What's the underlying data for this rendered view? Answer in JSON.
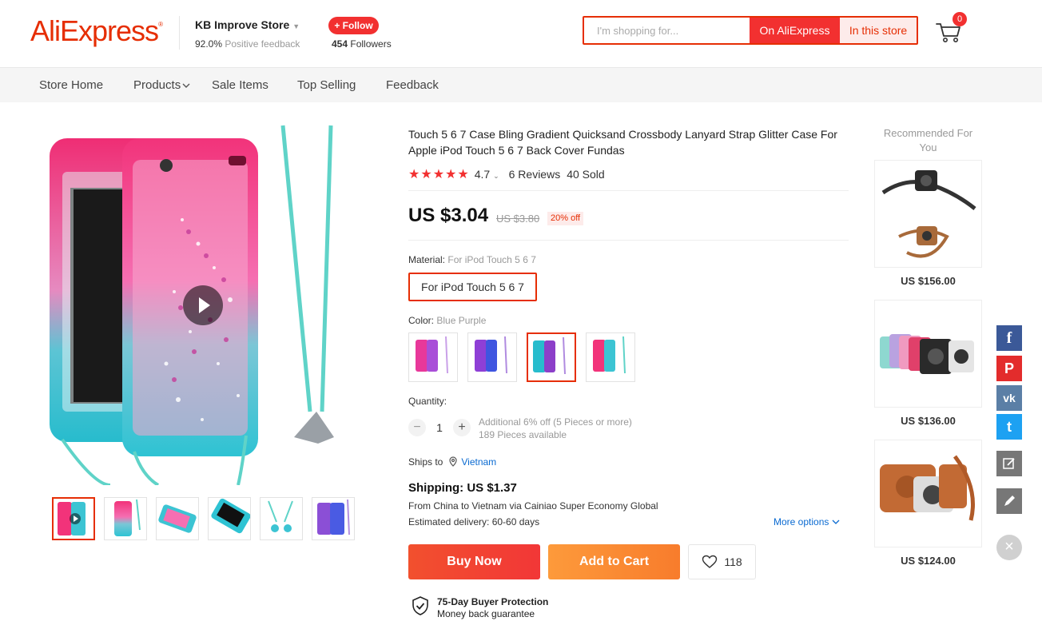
{
  "header": {
    "logo": "AliExpress",
    "logo_mark": "®",
    "store_name": "KB Improve Store",
    "feedback_pct": "92.0%",
    "feedback_label": "Positive feedback",
    "follow_label": "+ Follow",
    "followers_count": "454",
    "followers_label": "Followers",
    "search_placeholder": "I'm shopping for...",
    "search_aliexpress": "On AliExpress",
    "search_store": "In this store",
    "cart_count": "0"
  },
  "nav": {
    "items": [
      "Store Home",
      "Products",
      "Sale Items",
      "Top Selling",
      "Feedback"
    ]
  },
  "product": {
    "title": "Touch 5 6 7 Case Bling Gradient Quicksand Crossbody Lanyard Strap Glitter Case For Apple iPod Touch 5 6 7 Back Cover Fundas",
    "stars": "★★★★★",
    "rating": "4.7",
    "reviews": "6 Reviews",
    "sold": "40 Sold",
    "price": "US $3.04",
    "old_price": "US $3.80",
    "discount": "20% off",
    "material_label": "Material:",
    "material_value": "For iPod Touch 5 6 7",
    "material_option": "For iPod Touch 5 6 7",
    "color_label": "Color:",
    "color_value": "Blue Purple",
    "quantity_label": "Quantity:",
    "quantity": "1",
    "qty_minus": "−",
    "qty_plus": "+",
    "qty_discount": "Additional 6% off (5 Pieces or more)",
    "qty_available": "189 Pieces available",
    "ships_to_label": "Ships to",
    "ships_to_country": "Vietnam",
    "shipping": "Shipping: US $1.37",
    "ship_from": "From China to Vietnam via Cainiao Super Economy Global",
    "estimated": "Estimated delivery: 60-60 days",
    "more_options": "More options",
    "buy_now": "Buy Now",
    "add_to_cart": "Add to Cart",
    "wish_count": "118",
    "protection_title": "75-Day Buyer Protection",
    "protection_sub": "Money back guarantee"
  },
  "recommended": {
    "title": "Recommended For You",
    "prices": [
      "US $156.00",
      "US $136.00",
      "US $124.00"
    ]
  },
  "social": {
    "facebook": "f",
    "pinterest": "P",
    "vk": "vk",
    "twitter": "t",
    "close": "×"
  },
  "colors": {
    "brand": "#e62e04",
    "buy": "#f23737",
    "cart": "#fd8b33",
    "link": "#0a6ad1"
  }
}
